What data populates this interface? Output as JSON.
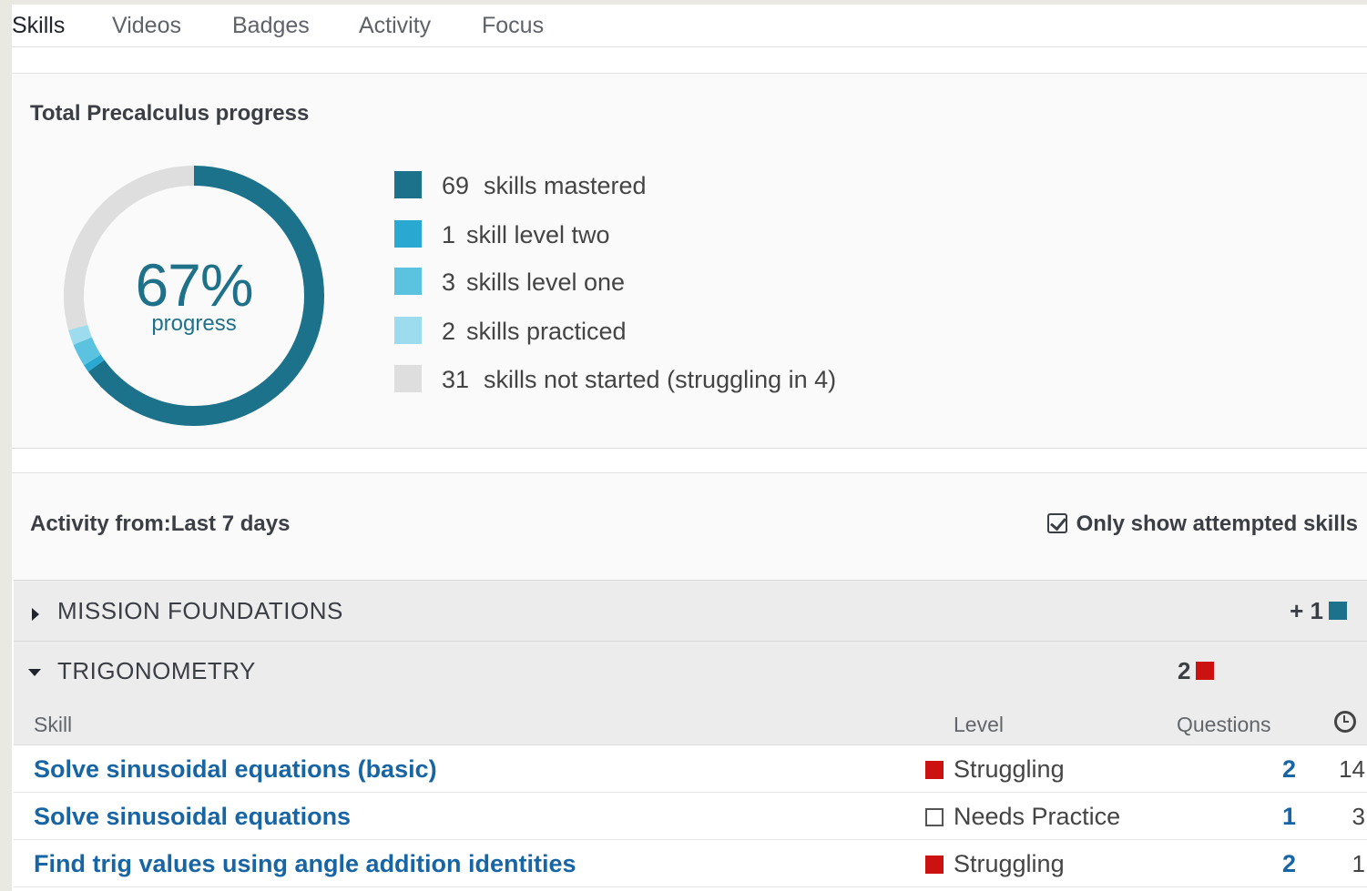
{
  "tabs": [
    {
      "label": "Skills",
      "active": true
    },
    {
      "label": "Videos",
      "active": false
    },
    {
      "label": "Badges",
      "active": false
    },
    {
      "label": "Activity",
      "active": false
    },
    {
      "label": "Focus",
      "active": false
    }
  ],
  "progress": {
    "title": "Total Precalculus progress",
    "percent": "67%",
    "percent_label": "progress",
    "legend": [
      {
        "count": "69",
        "text": "skills mastered",
        "color": "#1c728b",
        "value": 69
      },
      {
        "count": "1",
        "text": "skill level two",
        "color": "#29a9d1",
        "value": 1
      },
      {
        "count": "3",
        "text": "skills level one",
        "color": "#5bc3e0",
        "value": 3
      },
      {
        "count": "2",
        "text": "skills practiced",
        "color": "#9ddcee",
        "value": 2
      },
      {
        "count": "31",
        "text": "skills not started (struggling in 4)",
        "color": "#dedede",
        "value": 31
      }
    ]
  },
  "activity": {
    "label": "Activity from:Last 7 days",
    "only_show_label": "Only show attempted skills",
    "only_show_checked": true
  },
  "units": [
    {
      "title": "MISSION FOUNDATIONS",
      "expanded": false,
      "stat": "+ 1",
      "stat_color": "#1c728b"
    },
    {
      "title": "TRIGONOMETRY",
      "expanded": true,
      "stat": "2",
      "stat_color": "#cc1111"
    }
  ],
  "table": {
    "headers": {
      "skill": "Skill",
      "level": "Level",
      "questions": "Questions",
      "time_icon": "clock-icon"
    },
    "rows": [
      {
        "skill": "Solve sinusoidal equations (basic)",
        "level": "Struggling",
        "level_color": "#cc1111",
        "questions": "2",
        "time": "14"
      },
      {
        "skill": "Solve sinusoidal equations",
        "level": "Needs Practice",
        "level_color": "#ffffff",
        "questions": "1",
        "time": "3"
      },
      {
        "skill": "Find trig values using angle addition identities",
        "level": "Struggling",
        "level_color": "#cc1111",
        "questions": "2",
        "time": "1"
      }
    ]
  }
}
